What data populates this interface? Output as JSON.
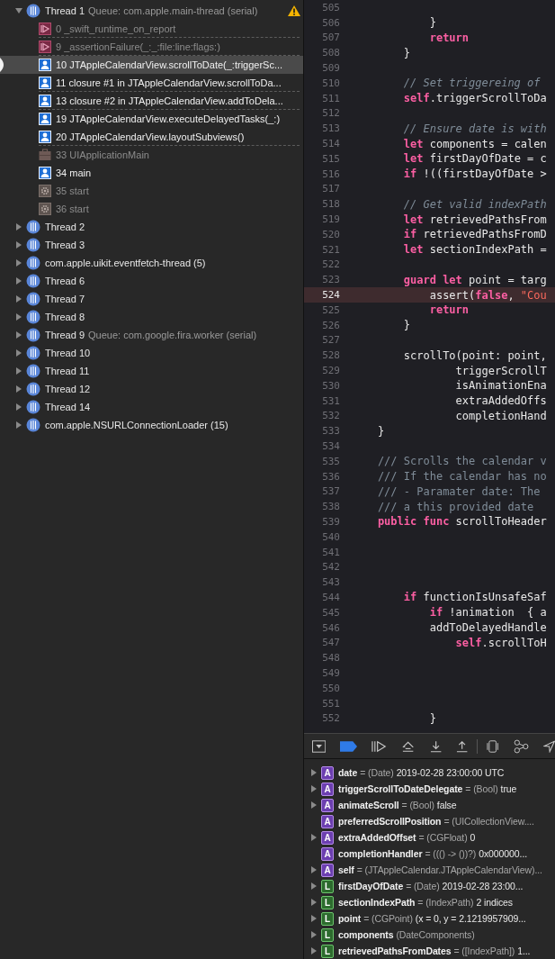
{
  "threads": [
    {
      "name": "Thread 1",
      "queue": "Queue: com.apple.main-thread (serial)",
      "expanded": true,
      "warning": true,
      "frames": [
        {
          "text": "0 _swift_runtime_on_report",
          "kind": "crash",
          "selected": false,
          "gap_after": true
        },
        {
          "text": "9 _assertionFailure(_:_:file:line:flags:)",
          "kind": "crash",
          "selected": false,
          "gap_after": true
        },
        {
          "text": "10 JTAppleCalendarView.scrollToDate(_:triggerSc...",
          "kind": "user",
          "selected": true,
          "gap_after": false
        },
        {
          "text": "11 closure #1 in JTAppleCalendarView.scrollToDa...",
          "kind": "user",
          "selected": false,
          "gap_after": true
        },
        {
          "text": "13 closure #2 in JTAppleCalendarView.addToDela...",
          "kind": "user",
          "selected": false,
          "gap_after": true
        },
        {
          "text": "19 JTAppleCalendarView.executeDelayedTasks(_:)",
          "kind": "user",
          "selected": false,
          "gap_after": false
        },
        {
          "text": "20 JTAppleCalendarView.layoutSubviews()",
          "kind": "user",
          "selected": false,
          "gap_after": true
        },
        {
          "text": "33 UIApplicationMain",
          "kind": "framework",
          "selected": false,
          "gap_after": false
        },
        {
          "text": "34 main",
          "kind": "user",
          "selected": false,
          "gap_after": false
        },
        {
          "text": "35 start",
          "kind": "system",
          "selected": false,
          "gap_after": false
        },
        {
          "text": "36 start",
          "kind": "system",
          "selected": false,
          "gap_after": false
        }
      ]
    },
    {
      "name": "Thread 2",
      "expanded": false,
      "warning": false
    },
    {
      "name": "Thread 3",
      "expanded": false,
      "warning": false
    },
    {
      "name": "com.apple.uikit.eventfetch-thread (5)",
      "expanded": false,
      "warning": false
    },
    {
      "name": "Thread 6",
      "expanded": false,
      "warning": false
    },
    {
      "name": "Thread 7",
      "expanded": false,
      "warning": false
    },
    {
      "name": "Thread 8",
      "expanded": false,
      "warning": false
    },
    {
      "name": "Thread 9",
      "queue": "Queue: com.google.fira.worker (serial)",
      "expanded": false,
      "warning": false
    },
    {
      "name": "Thread 10",
      "expanded": false,
      "warning": false
    },
    {
      "name": "Thread 11",
      "expanded": false,
      "warning": false
    },
    {
      "name": "Thread 12",
      "expanded": false,
      "warning": false
    },
    {
      "name": "Thread 14",
      "expanded": false,
      "warning": false
    },
    {
      "name": "com.apple.NSURLConnectionLoader (15)",
      "expanded": false,
      "warning": false
    }
  ],
  "code": [
    {
      "number": "505",
      "current": false
    },
    {
      "number": "506",
      "current": false,
      "tokens": [
        {
          "text": "            }",
          "kind": "plain"
        }
      ]
    },
    {
      "number": "507",
      "current": false,
      "tokens": [
        {
          "text": "            return",
          "kind": "keyword"
        }
      ]
    },
    {
      "number": "508",
      "current": false,
      "tokens": [
        {
          "text": "        }",
          "kind": "plain"
        }
      ]
    },
    {
      "number": "509",
      "current": false
    },
    {
      "number": "510",
      "current": false,
      "tokens": [
        {
          "text": "        // Set triggereing of",
          "kind": "comment"
        }
      ]
    },
    {
      "number": "511",
      "current": false,
      "tokens": [
        {
          "text": "        self",
          "kind": "keyword"
        },
        {
          "text": ".triggerScrollToDa",
          "kind": "plain"
        }
      ]
    },
    {
      "number": "512",
      "current": false
    },
    {
      "number": "513",
      "current": false,
      "tokens": [
        {
          "text": "        // Ensure date is with",
          "kind": "comment"
        }
      ]
    },
    {
      "number": "514",
      "current": false,
      "tokens": [
        {
          "text": "        let",
          "kind": "keyword"
        },
        {
          "text": " components = calen",
          "kind": "plain"
        }
      ]
    },
    {
      "number": "515",
      "current": false,
      "tokens": [
        {
          "text": "        let",
          "kind": "keyword"
        },
        {
          "text": " firstDayOfDate = c",
          "kind": "plain"
        }
      ]
    },
    {
      "number": "516",
      "current": false,
      "tokens": [
        {
          "text": "        if",
          "kind": "keyword"
        },
        {
          "text": " !((firstDayOfDate >",
          "kind": "plain"
        }
      ]
    },
    {
      "number": "517",
      "current": false
    },
    {
      "number": "518",
      "current": false,
      "tokens": [
        {
          "text": "        // Get valid indexPath",
          "kind": "comment"
        }
      ]
    },
    {
      "number": "519",
      "current": false,
      "tokens": [
        {
          "text": "        let",
          "kind": "keyword"
        },
        {
          "text": " retrievedPathsFrom",
          "kind": "plain"
        }
      ]
    },
    {
      "number": "520",
      "current": false,
      "tokens": [
        {
          "text": "        if",
          "kind": "keyword"
        },
        {
          "text": " retrievedPathsFromD",
          "kind": "plain"
        }
      ]
    },
    {
      "number": "521",
      "current": false,
      "tokens": [
        {
          "text": "        let",
          "kind": "keyword"
        },
        {
          "text": " sectionIndexPath =",
          "kind": "plain"
        }
      ]
    },
    {
      "number": "522",
      "current": false
    },
    {
      "number": "523",
      "current": false,
      "tokens": [
        {
          "text": "        guard let",
          "kind": "keyword"
        },
        {
          "text": " point = targ",
          "kind": "plain"
        }
      ]
    },
    {
      "number": "524",
      "current": true,
      "tokens": [
        {
          "text": "            assert(",
          "kind": "plain"
        },
        {
          "text": "false",
          "kind": "keyword"
        },
        {
          "text": ", ",
          "kind": "plain"
        },
        {
          "text": "\"Cou",
          "kind": "string"
        }
      ]
    },
    {
      "number": "525",
      "current": false,
      "tokens": [
        {
          "text": "            return",
          "kind": "keyword"
        }
      ]
    },
    {
      "number": "526",
      "current": false,
      "tokens": [
        {
          "text": "        }",
          "kind": "plain"
        }
      ]
    },
    {
      "number": "527",
      "current": false
    },
    {
      "number": "528",
      "current": false,
      "tokens": [
        {
          "text": "        scrollTo(point: point,",
          "kind": "plain"
        }
      ]
    },
    {
      "number": "529",
      "current": false,
      "tokens": [
        {
          "text": "                triggerScrollT",
          "kind": "plain"
        }
      ]
    },
    {
      "number": "530",
      "current": false,
      "tokens": [
        {
          "text": "                isAnimationEna",
          "kind": "plain"
        }
      ]
    },
    {
      "number": "531",
      "current": false,
      "tokens": [
        {
          "text": "                extraAddedOffs",
          "kind": "plain"
        }
      ]
    },
    {
      "number": "532",
      "current": false,
      "tokens": [
        {
          "text": "                completionHand",
          "kind": "plain"
        }
      ]
    },
    {
      "number": "533",
      "current": false,
      "tokens": [
        {
          "text": "    }",
          "kind": "plain"
        }
      ]
    },
    {
      "number": "534",
      "current": false
    },
    {
      "number": "535",
      "current": false,
      "tokens": [
        {
          "text": "    /// Scrolls the calendar v",
          "kind": "doc"
        }
      ]
    },
    {
      "number": "536",
      "current": false,
      "tokens": [
        {
          "text": "    /// If the calendar has no",
          "kind": "doc"
        }
      ]
    },
    {
      "number": "537",
      "current": false,
      "tokens": [
        {
          "text": "    /// - Paramater date: The",
          "kind": "doc"
        }
      ]
    },
    {
      "number": "538",
      "current": false,
      "tokens": [
        {
          "text": "    /// a this provided date",
          "kind": "doc"
        }
      ]
    },
    {
      "number": "539",
      "current": false,
      "tokens": [
        {
          "text": "    public func",
          "kind": "keyword"
        },
        {
          "text": " scrollToHeader",
          "kind": "plain"
        }
      ]
    },
    {
      "number": "540",
      "current": false
    },
    {
      "number": "541",
      "current": false
    },
    {
      "number": "542",
      "current": false
    },
    {
      "number": "543",
      "current": false
    },
    {
      "number": "544",
      "current": false,
      "tokens": [
        {
          "text": "        if",
          "kind": "keyword"
        },
        {
          "text": " functionIsUnsafeSaf",
          "kind": "plain"
        }
      ]
    },
    {
      "number": "545",
      "current": false,
      "tokens": [
        {
          "text": "            if",
          "kind": "keyword"
        },
        {
          "text": " !animation  { a",
          "kind": "plain"
        }
      ]
    },
    {
      "number": "546",
      "current": false,
      "tokens": [
        {
          "text": "            addToDelayedHandle",
          "kind": "plain"
        }
      ]
    },
    {
      "number": "547",
      "current": false,
      "tokens": [
        {
          "text": "                self",
          "kind": "keyword"
        },
        {
          "text": ".scrollToH",
          "kind": "plain"
        }
      ]
    },
    {
      "number": "548",
      "current": false
    },
    {
      "number": "549",
      "current": false
    },
    {
      "number": "550",
      "current": false
    },
    {
      "number": "551",
      "current": false
    },
    {
      "number": "552",
      "current": false,
      "tokens": [
        {
          "text": "            }",
          "kind": "plain"
        }
      ]
    }
  ],
  "variables": [
    {
      "kind": "argument",
      "badge": "A",
      "expandable": true,
      "name": "date",
      "detail": "= (Date)",
      "value": "2019-02-28 23:00:00 UTC"
    },
    {
      "kind": "argument",
      "badge": "A",
      "expandable": true,
      "name": "triggerScrollToDateDelegate",
      "detail": "= (Bool)",
      "value": "true"
    },
    {
      "kind": "argument",
      "badge": "A",
      "expandable": true,
      "name": "animateScroll",
      "detail": "= (Bool)",
      "value": "false"
    },
    {
      "kind": "argument",
      "badge": "A",
      "expandable": false,
      "name": "preferredScrollPosition",
      "detail": "= (UICollectionView...."
    },
    {
      "kind": "argument",
      "badge": "A",
      "expandable": true,
      "name": "extraAddedOffset",
      "detail": "= (CGFloat)",
      "value": "0"
    },
    {
      "kind": "argument",
      "badge": "A",
      "expandable": false,
      "name": "completionHandler",
      "detail": "= ((() -> ())?)",
      "value": "0x000000..."
    },
    {
      "kind": "argument",
      "badge": "A",
      "expandable": true,
      "name": "self",
      "detail": "= (JTAppleCalendar.JTAppleCalendarView)..."
    },
    {
      "kind": "local",
      "badge": "L",
      "expandable": true,
      "name": "firstDayOfDate",
      "detail": "= (Date)",
      "value": "2019-02-28 23:00..."
    },
    {
      "kind": "local",
      "badge": "L",
      "expandable": true,
      "name": "sectionIndexPath",
      "detail": "= (IndexPath)",
      "value": "2 indices"
    },
    {
      "kind": "local",
      "badge": "L",
      "expandable": true,
      "name": "point",
      "detail": "= (CGPoint)",
      "value": "(x = 0, y = 2.1219957909..."
    },
    {
      "kind": "local",
      "badge": "L",
      "expandable": true,
      "name": "components",
      "detail": "(DateComponents)"
    },
    {
      "kind": "local",
      "badge": "L",
      "expandable": true,
      "name": "retrievedPathsFromDates",
      "detail": "= ([IndexPath])",
      "value": "1..."
    }
  ]
}
